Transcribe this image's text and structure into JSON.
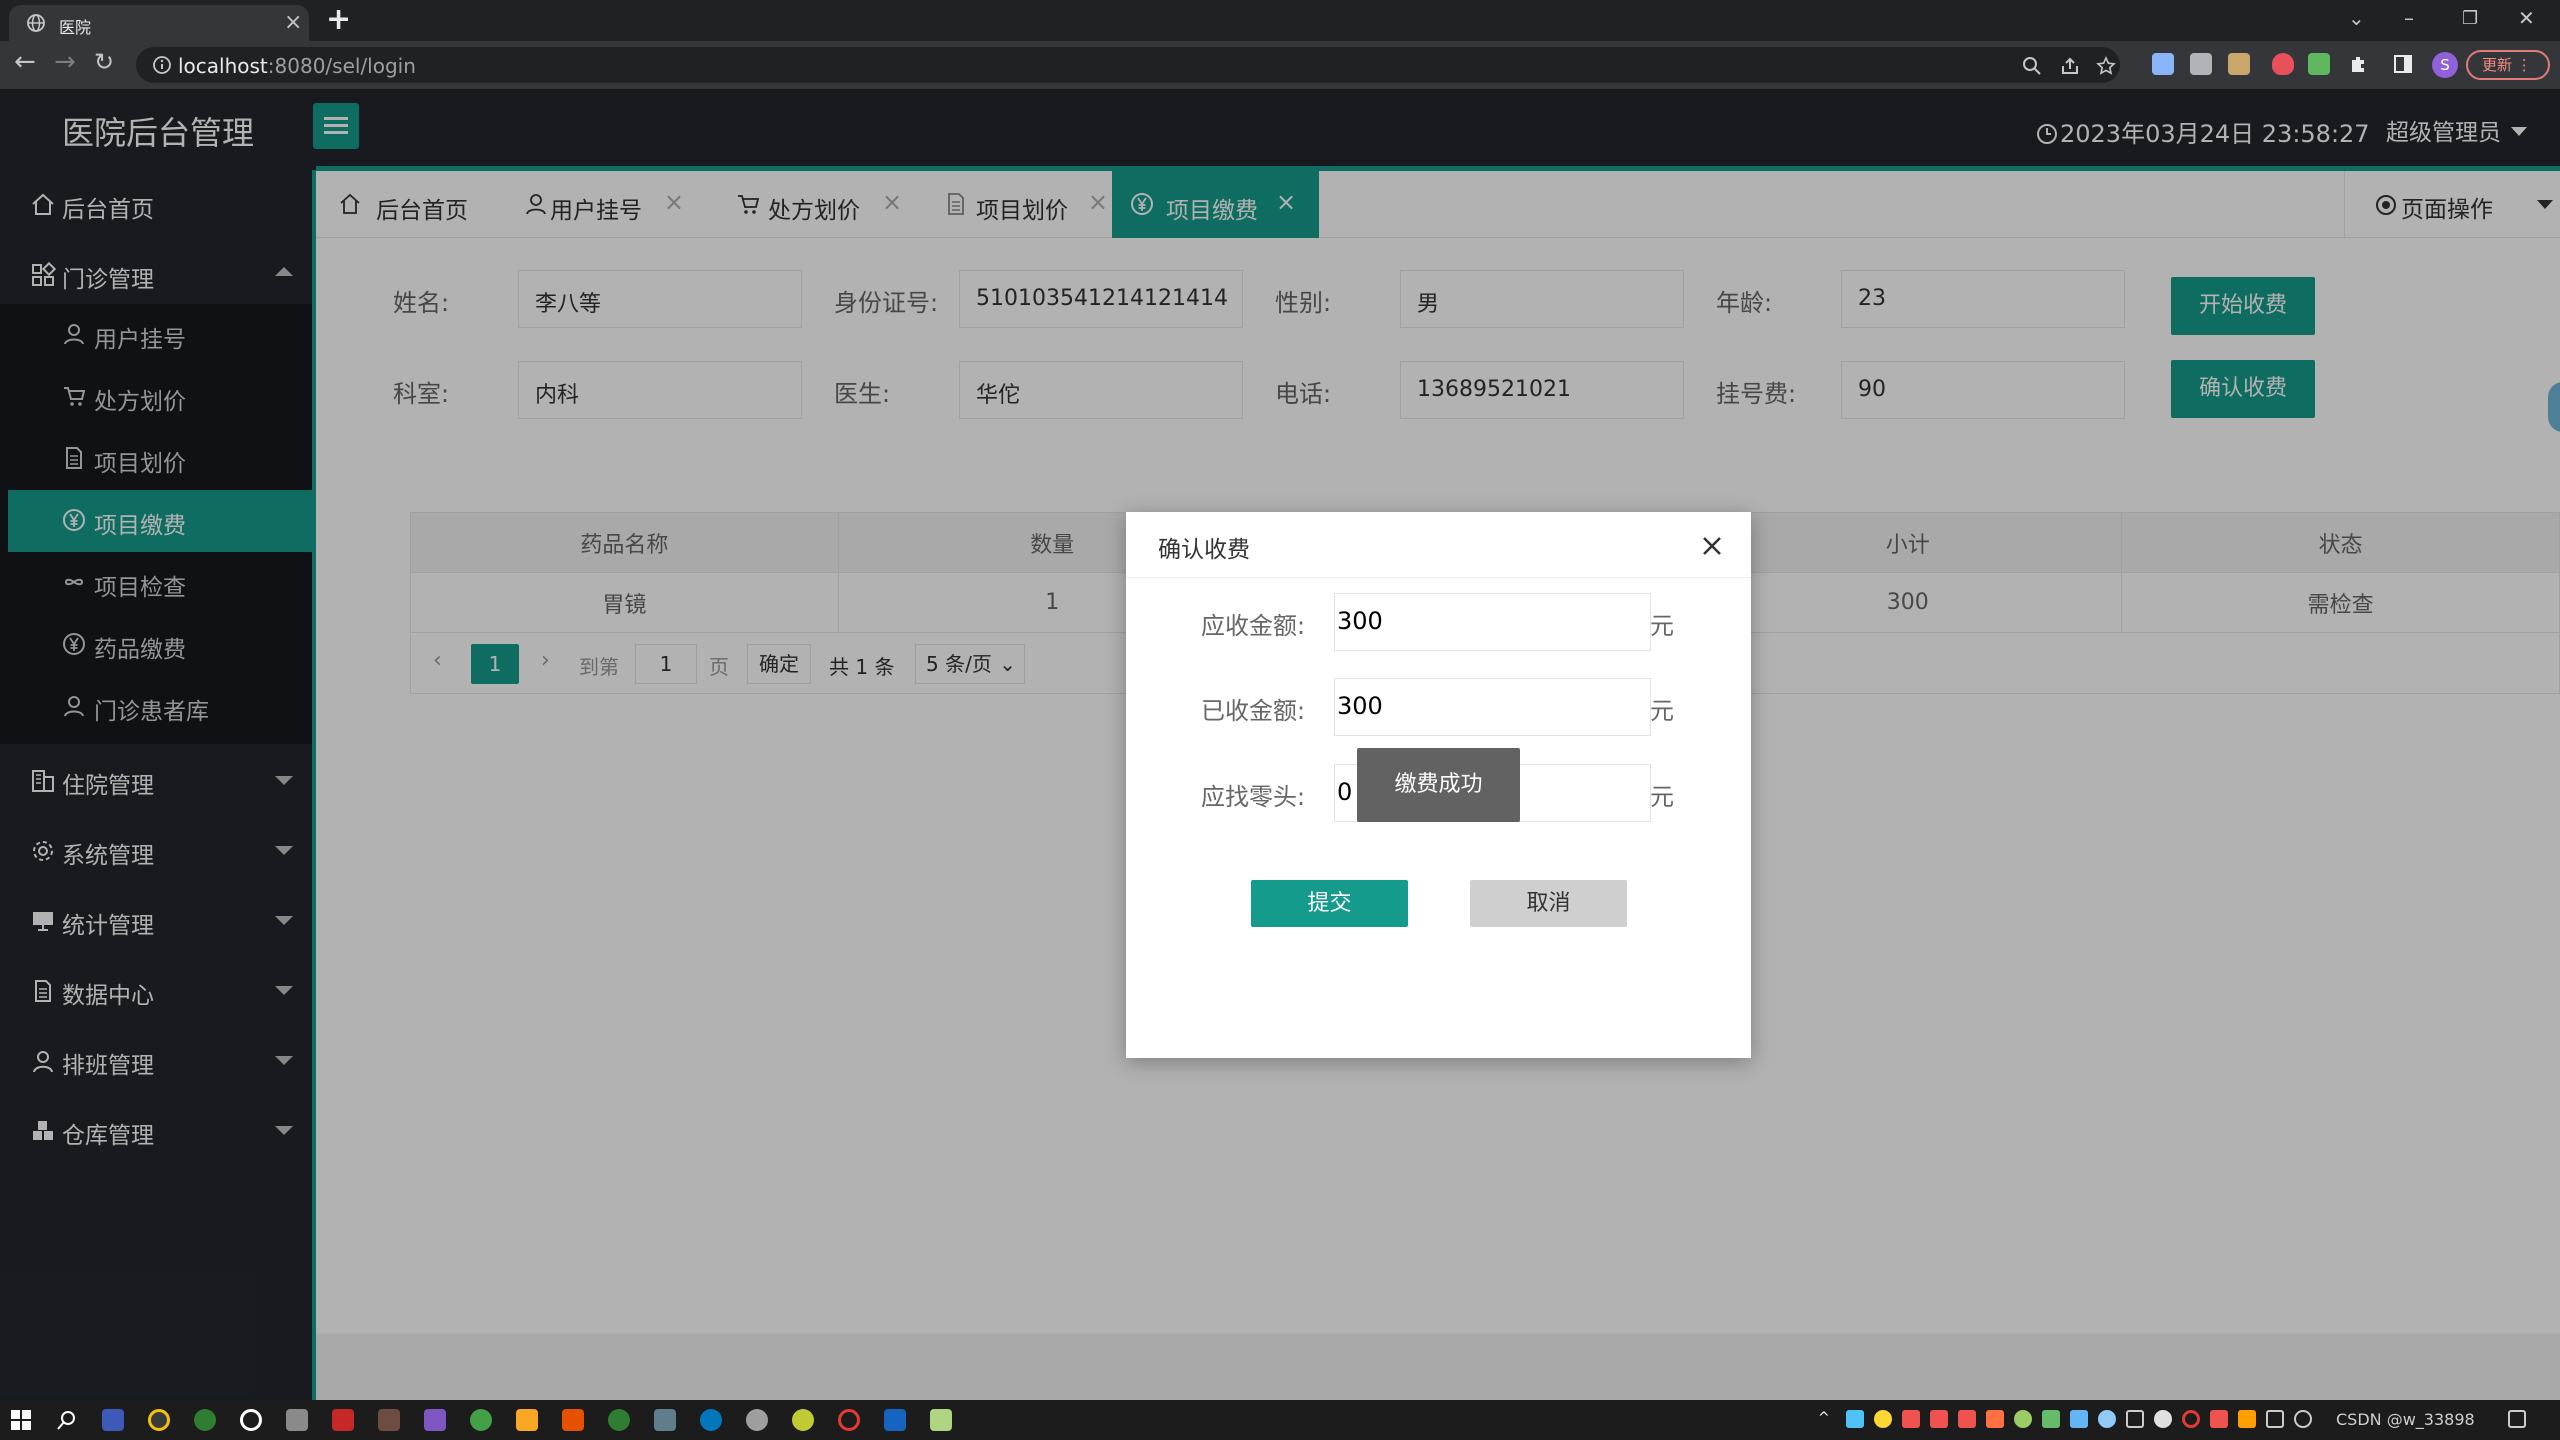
{
  "browser": {
    "tab_title": "医院",
    "new_tab": "+",
    "url_host": "localhost",
    "url_path": ":8080/sel/login",
    "update_label": "更新",
    "profile_initial": "S"
  },
  "header": {
    "app_title": "医院后台管理",
    "datetime": "2023年03月24日 23:58:27",
    "user": "超级管理员"
  },
  "sidebar": {
    "home": "后台首页",
    "outpatient": "门诊管理",
    "sub_items": [
      "用户挂号",
      "处方划价",
      "项目划价",
      "项目缴费",
      "项目检查",
      "药品缴费",
      "门诊患者库"
    ],
    "groups": [
      "住院管理",
      "系统管理",
      "统计管理",
      "数据中心",
      "排班管理",
      "仓库管理"
    ]
  },
  "tabs": {
    "items": [
      "后台首页",
      "用户挂号",
      "处方划价",
      "项目划价",
      "项目缴费"
    ],
    "active": "项目缴费",
    "page_ops": "页面操作"
  },
  "form": {
    "name_label": "姓名:",
    "name_value": "李八等",
    "id_label": "身份证号:",
    "id_value": "510103541214121414",
    "gender_label": "性别:",
    "gender_value": "男",
    "age_label": "年龄:",
    "age_value": "23",
    "dept_label": "科室:",
    "dept_value": "内科",
    "doctor_label": "医生:",
    "doctor_value": "华佗",
    "phone_label": "电话:",
    "phone_value": "13689521021",
    "fee_label": "挂号费:",
    "fee_value": "90",
    "start_btn": "开始收费",
    "confirm_btn": "确认收费"
  },
  "table": {
    "headers": [
      "药品名称",
      "数量",
      "小计",
      "状态"
    ],
    "row": {
      "name": "胃镜",
      "qty": "1",
      "subtotal": "300",
      "status": "需检查"
    }
  },
  "pager": {
    "current": "1",
    "goto_label": "到第",
    "goto_value": "1",
    "page_unit": "页",
    "confirm": "确定",
    "total": "共 1 条",
    "page_size": "5 条/页"
  },
  "modal": {
    "title": "确认收费",
    "receivable_label": "应收金额:",
    "receivable_value": "300",
    "received_label": "已收金额:",
    "received_value": "300",
    "change_label": "应找零头:",
    "change_value": "0",
    "unit": "元",
    "submit": "提交",
    "cancel": "取消",
    "toast": "缴费成功"
  },
  "taskbar": {
    "tray_text": "CSDN @w_33898"
  },
  "colors": {
    "accent": "#159b8c",
    "sidebar_bg": "#23262e",
    "status_red": "#d7221d"
  }
}
